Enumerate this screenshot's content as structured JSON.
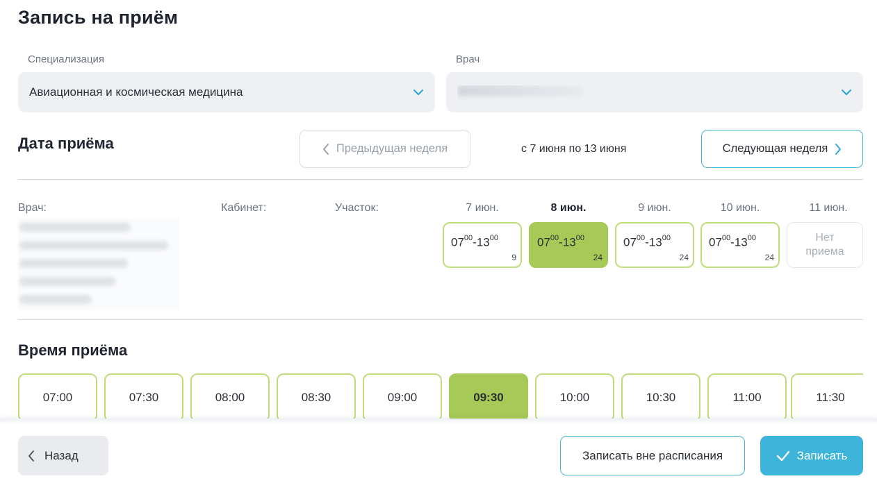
{
  "page": {
    "title": "Запись на приём"
  },
  "form": {
    "specialization": {
      "label": "Специализация",
      "value": "Авиационная и космическая медицина",
      "icon": "chevron-down-icon"
    },
    "doctor": {
      "label": "Врач",
      "icon": "chevron-down-icon"
    }
  },
  "date_section": {
    "title": "Дата приёма",
    "prev_week": "Предыдущая неделя",
    "range": "с 7 июня по 13 июня",
    "next_week": "Следующая неделя",
    "columns": {
      "doctor": "Врач:",
      "cabinet": "Кабинет:",
      "area": "Участок:"
    },
    "days": [
      {
        "label": "7 июн.",
        "selected": false,
        "slot": {
          "start_h": "07",
          "start_m": "00",
          "end_h": "13",
          "end_m": "00",
          "count": "9"
        }
      },
      {
        "label": "8 июн.",
        "selected": true,
        "slot": {
          "start_h": "07",
          "start_m": "00",
          "end_h": "13",
          "end_m": "00",
          "count": "24"
        }
      },
      {
        "label": "9 июн.",
        "selected": false,
        "slot": {
          "start_h": "07",
          "start_m": "00",
          "end_h": "13",
          "end_m": "00",
          "count": "24"
        }
      },
      {
        "label": "10 июн.",
        "selected": false,
        "slot": {
          "start_h": "07",
          "start_m": "00",
          "end_h": "13",
          "end_m": "00",
          "count": "24"
        }
      },
      {
        "label": "11 июн.",
        "selected": false,
        "no_slot_line1": "Нет",
        "no_slot_line2": "приема"
      }
    ]
  },
  "time_section": {
    "title": "Время приёма",
    "slots": [
      "07:00",
      "07:30",
      "08:00",
      "08:30",
      "09:00",
      "09:30",
      "10:00",
      "10:30",
      "11:00",
      "11:30"
    ],
    "selected_index": 5
  },
  "footer": {
    "back": "Назад",
    "off_schedule": "Записать вне расписания",
    "submit": "Записать"
  },
  "colors": {
    "accent_green": "#a7c957",
    "slot_border": "#bfdc7a",
    "accent_blue": "#3fb4db"
  }
}
